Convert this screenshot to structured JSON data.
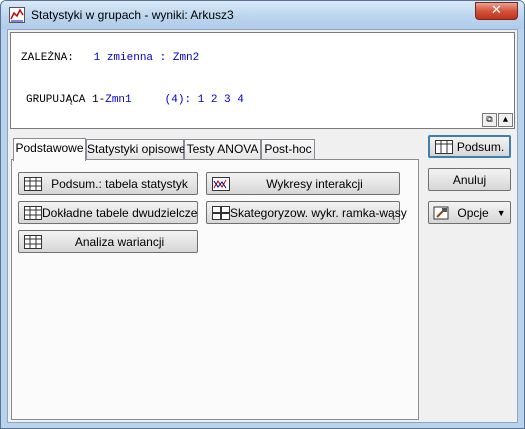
{
  "window": {
    "title": "Statystyki w grupach - wyniki: Arkusz3",
    "close_label": "✕"
  },
  "info": {
    "dependent_label": "ZALEŻNA:",
    "dependent_count": "1 zmienna :",
    "dependent_var": "Zmn2",
    "grouping_label": "GRUPUJĄCA 1-",
    "grouping_var": "Zmn1",
    "grouping_levels": "(4):",
    "grouping_values": "1 2 3 4"
  },
  "tabs": [
    {
      "label": "Podstawowe"
    },
    {
      "label": "Statystyki opisowe"
    },
    {
      "label": "Testy ANOVA"
    },
    {
      "label": "Post-hoc"
    }
  ],
  "buttons": {
    "summary_table": "Podsum.: tabela statystyk",
    "interaction_plots": "Wykresy interakcji",
    "detailed_tables": "Dokładne tabele dwudzielcze",
    "categorized_boxplot": "Skategoryzow. wykr. ramka-wąsy",
    "anova": "Analiza wariancji"
  },
  "side": {
    "summary": "Podsum.",
    "cancel": "Anuluj",
    "options": "Opcje"
  },
  "icons": {
    "app": "chart-app-icon",
    "table": "table-icon",
    "interaction": "interaction-plot-icon",
    "boxplot": "boxplot-icon",
    "options": "hammer-icon"
  }
}
